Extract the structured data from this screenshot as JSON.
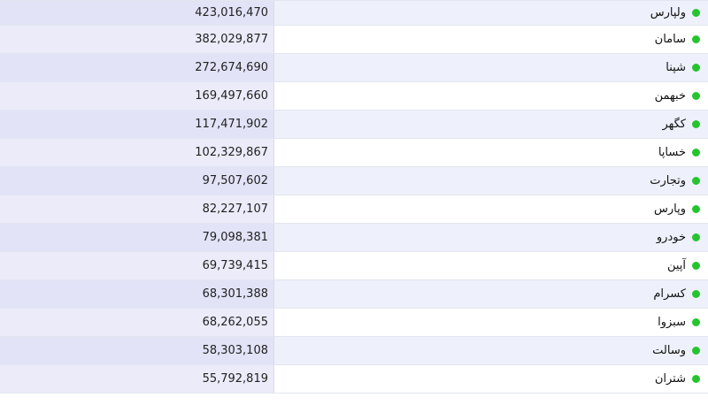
{
  "colors": {
    "indicator": "#25c42f"
  },
  "table": {
    "rows": [
      {
        "name": "ولپارس",
        "value": "423,016,470"
      },
      {
        "name": "سامان",
        "value": "382,029,877"
      },
      {
        "name": "شپنا",
        "value": "272,674,690"
      },
      {
        "name": "خبهمن",
        "value": "169,497,660"
      },
      {
        "name": "کگهر",
        "value": "117,471,902"
      },
      {
        "name": "خساپا",
        "value": "102,329,867"
      },
      {
        "name": "وتجارت",
        "value": "97,507,602"
      },
      {
        "name": "وپارس",
        "value": "82,227,107"
      },
      {
        "name": "خودرو",
        "value": "79,098,381"
      },
      {
        "name": "آپین",
        "value": "69,739,415"
      },
      {
        "name": "کسرام",
        "value": "68,301,388"
      },
      {
        "name": "سبزوا",
        "value": "68,262,055"
      },
      {
        "name": "وسالت",
        "value": "58,303,108"
      },
      {
        "name": "شتران",
        "value": "55,792,819"
      }
    ]
  }
}
